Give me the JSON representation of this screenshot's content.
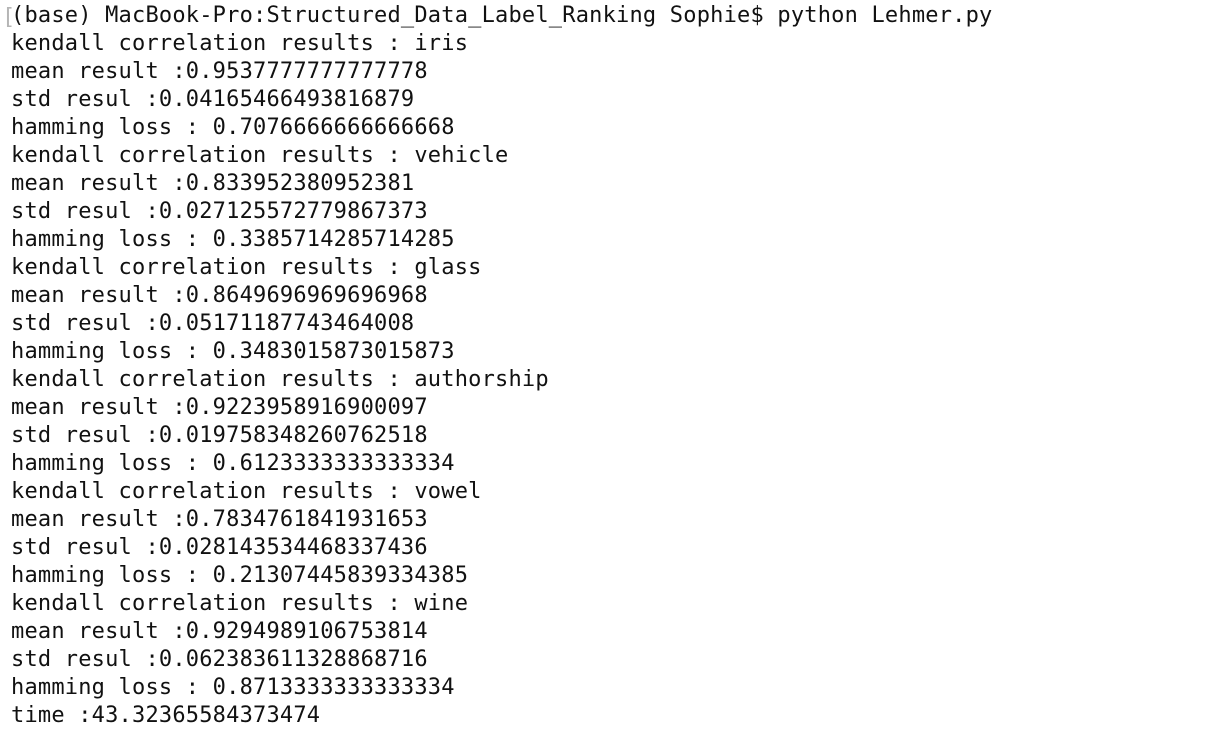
{
  "terminal": {
    "prompt_marker": "[",
    "lines": [
      "(base) MacBook-Pro:Structured_Data_Label_Ranking Sophie$ python Lehmer.py",
      "kendall correlation results : iris",
      "mean result :0.9537777777777778",
      "std resul :0.04165466493816879",
      "hamming loss : 0.7076666666666668",
      "kendall correlation results : vehicle",
      "mean result :0.833952380952381",
      "std resul :0.027125572779867373",
      "hamming loss : 0.3385714285714285",
      "kendall correlation results : glass",
      "mean result :0.8649696969696968",
      "std resul :0.05171187743464008",
      "hamming loss : 0.3483015873015873",
      "kendall correlation results : authorship",
      "mean result :0.9223958916900097",
      "std resul :0.019758348260762518",
      "hamming loss : 0.6123333333333334",
      "kendall correlation results : vowel",
      "mean result :0.7834761841931653",
      "std resul :0.028143534468337436",
      "hamming loss : 0.21307445839334385",
      "kendall correlation results : wine",
      "mean result :0.9294989106753814",
      "std resul :0.062383611328868716",
      "hamming loss : 0.8713333333333334",
      "time :43.32365584373474"
    ]
  }
}
